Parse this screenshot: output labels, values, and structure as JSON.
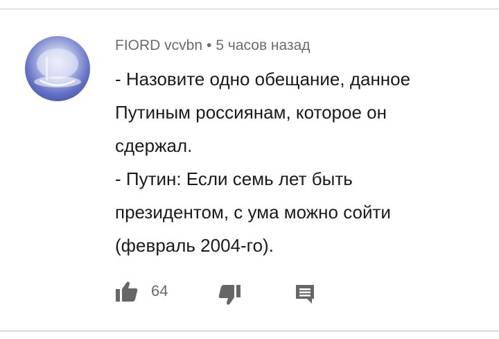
{
  "comment": {
    "author": "FIORD vcvbn",
    "separator": "•",
    "time": "5 часов назад",
    "lines": [
      "- Назовите одно обещание, данное",
      "Путиным россиянам, которое он",
      "сдержал.",
      "- Путин: Если семь лет быть",
      "президентом, с ума можно сойти",
      "(февраль 2004-го)."
    ]
  },
  "actions": {
    "like_count": "64",
    "like_icon": "thumb-up-icon",
    "dislike_icon": "thumb-down-icon",
    "reply_icon": "comment-icon"
  },
  "colors": {
    "meta_text": "#6b6b6b",
    "body_text": "#1a1a1a",
    "icon": "#666666",
    "divider": "#e2e2e2"
  }
}
